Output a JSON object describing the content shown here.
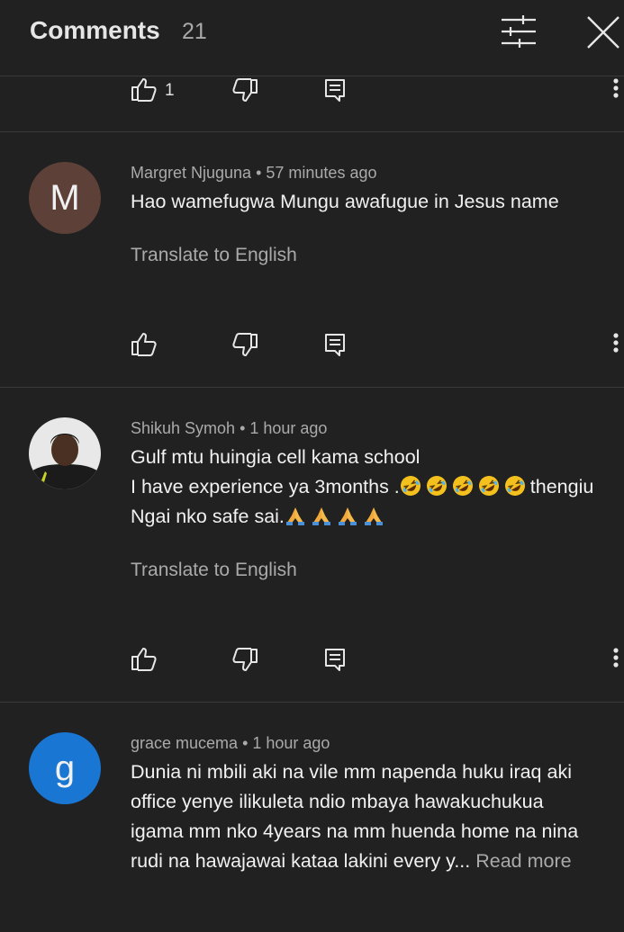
{
  "header": {
    "title": "Comments",
    "count": "21"
  },
  "first_partial": {
    "like_count": "1"
  },
  "comments": [
    {
      "author": "Margret Njuguna",
      "time": "57 minutes ago",
      "avatar_letter": "M",
      "avatar_color": "#5d4037",
      "lines": [
        "Hao wamefugwa Mungu  awafugue in Jesus name"
      ],
      "translate": "Translate to English"
    },
    {
      "author": "Shikuh Symoh",
      "time": "1 hour ago",
      "avatar_letter": "",
      "lines": [
        "Gulf mtu huingia cell kama school",
        "I have experience ya 3months .",
        "thengiu",
        "Ngai nko safe sai."
      ],
      "translate": "Translate to English"
    },
    {
      "author": "grace mucema",
      "time": "1 hour ago",
      "avatar_letter": "g",
      "avatar_color": "#1976d2",
      "lines": [
        "Dunia ni mbili aki na vile mm napenda huku iraq aki",
        "office yenye ilikuleta ndio mbaya hawakuchukua",
        "igama  mm nko 4years na mm huenda home na nina",
        "rudi na hawajawai kataa lakini every y... "
      ],
      "read_more": "Read more"
    }
  ],
  "separator": " • ",
  "icons": [
    "filter-icon",
    "close-icon",
    "thumb-up-icon",
    "thumb-down-icon",
    "reply-icon",
    "more-vert-icon",
    "rofl-emoji",
    "folded-hands-emoji"
  ]
}
